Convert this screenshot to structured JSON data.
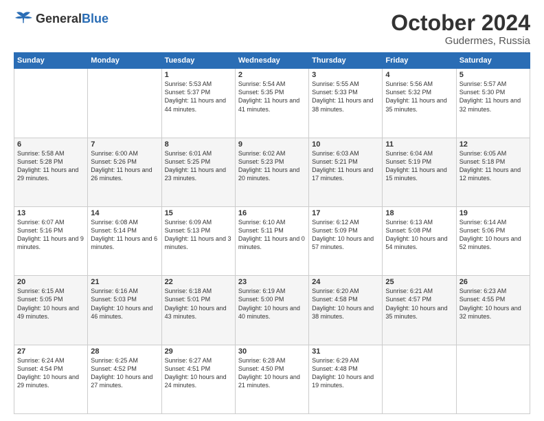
{
  "header": {
    "logo_general": "General",
    "logo_blue": "Blue",
    "month": "October 2024",
    "location": "Gudermes, Russia"
  },
  "days_of_week": [
    "Sunday",
    "Monday",
    "Tuesday",
    "Wednesday",
    "Thursday",
    "Friday",
    "Saturday"
  ],
  "weeks": [
    [
      {
        "day": "",
        "content": ""
      },
      {
        "day": "",
        "content": ""
      },
      {
        "day": "1",
        "content": "Sunrise: 5:53 AM\nSunset: 5:37 PM\nDaylight: 11 hours and 44 minutes."
      },
      {
        "day": "2",
        "content": "Sunrise: 5:54 AM\nSunset: 5:35 PM\nDaylight: 11 hours and 41 minutes."
      },
      {
        "day": "3",
        "content": "Sunrise: 5:55 AM\nSunset: 5:33 PM\nDaylight: 11 hours and 38 minutes."
      },
      {
        "day": "4",
        "content": "Sunrise: 5:56 AM\nSunset: 5:32 PM\nDaylight: 11 hours and 35 minutes."
      },
      {
        "day": "5",
        "content": "Sunrise: 5:57 AM\nSunset: 5:30 PM\nDaylight: 11 hours and 32 minutes."
      }
    ],
    [
      {
        "day": "6",
        "content": "Sunrise: 5:58 AM\nSunset: 5:28 PM\nDaylight: 11 hours and 29 minutes."
      },
      {
        "day": "7",
        "content": "Sunrise: 6:00 AM\nSunset: 5:26 PM\nDaylight: 11 hours and 26 minutes."
      },
      {
        "day": "8",
        "content": "Sunrise: 6:01 AM\nSunset: 5:25 PM\nDaylight: 11 hours and 23 minutes."
      },
      {
        "day": "9",
        "content": "Sunrise: 6:02 AM\nSunset: 5:23 PM\nDaylight: 11 hours and 20 minutes."
      },
      {
        "day": "10",
        "content": "Sunrise: 6:03 AM\nSunset: 5:21 PM\nDaylight: 11 hours and 17 minutes."
      },
      {
        "day": "11",
        "content": "Sunrise: 6:04 AM\nSunset: 5:19 PM\nDaylight: 11 hours and 15 minutes."
      },
      {
        "day": "12",
        "content": "Sunrise: 6:05 AM\nSunset: 5:18 PM\nDaylight: 11 hours and 12 minutes."
      }
    ],
    [
      {
        "day": "13",
        "content": "Sunrise: 6:07 AM\nSunset: 5:16 PM\nDaylight: 11 hours and 9 minutes."
      },
      {
        "day": "14",
        "content": "Sunrise: 6:08 AM\nSunset: 5:14 PM\nDaylight: 11 hours and 6 minutes."
      },
      {
        "day": "15",
        "content": "Sunrise: 6:09 AM\nSunset: 5:13 PM\nDaylight: 11 hours and 3 minutes."
      },
      {
        "day": "16",
        "content": "Sunrise: 6:10 AM\nSunset: 5:11 PM\nDaylight: 11 hours and 0 minutes."
      },
      {
        "day": "17",
        "content": "Sunrise: 6:12 AM\nSunset: 5:09 PM\nDaylight: 10 hours and 57 minutes."
      },
      {
        "day": "18",
        "content": "Sunrise: 6:13 AM\nSunset: 5:08 PM\nDaylight: 10 hours and 54 minutes."
      },
      {
        "day": "19",
        "content": "Sunrise: 6:14 AM\nSunset: 5:06 PM\nDaylight: 10 hours and 52 minutes."
      }
    ],
    [
      {
        "day": "20",
        "content": "Sunrise: 6:15 AM\nSunset: 5:05 PM\nDaylight: 10 hours and 49 minutes."
      },
      {
        "day": "21",
        "content": "Sunrise: 6:16 AM\nSunset: 5:03 PM\nDaylight: 10 hours and 46 minutes."
      },
      {
        "day": "22",
        "content": "Sunrise: 6:18 AM\nSunset: 5:01 PM\nDaylight: 10 hours and 43 minutes."
      },
      {
        "day": "23",
        "content": "Sunrise: 6:19 AM\nSunset: 5:00 PM\nDaylight: 10 hours and 40 minutes."
      },
      {
        "day": "24",
        "content": "Sunrise: 6:20 AM\nSunset: 4:58 PM\nDaylight: 10 hours and 38 minutes."
      },
      {
        "day": "25",
        "content": "Sunrise: 6:21 AM\nSunset: 4:57 PM\nDaylight: 10 hours and 35 minutes."
      },
      {
        "day": "26",
        "content": "Sunrise: 6:23 AM\nSunset: 4:55 PM\nDaylight: 10 hours and 32 minutes."
      }
    ],
    [
      {
        "day": "27",
        "content": "Sunrise: 6:24 AM\nSunset: 4:54 PM\nDaylight: 10 hours and 29 minutes."
      },
      {
        "day": "28",
        "content": "Sunrise: 6:25 AM\nSunset: 4:52 PM\nDaylight: 10 hours and 27 minutes."
      },
      {
        "day": "29",
        "content": "Sunrise: 6:27 AM\nSunset: 4:51 PM\nDaylight: 10 hours and 24 minutes."
      },
      {
        "day": "30",
        "content": "Sunrise: 6:28 AM\nSunset: 4:50 PM\nDaylight: 10 hours and 21 minutes."
      },
      {
        "day": "31",
        "content": "Sunrise: 6:29 AM\nSunset: 4:48 PM\nDaylight: 10 hours and 19 minutes."
      },
      {
        "day": "",
        "content": ""
      },
      {
        "day": "",
        "content": ""
      }
    ]
  ]
}
